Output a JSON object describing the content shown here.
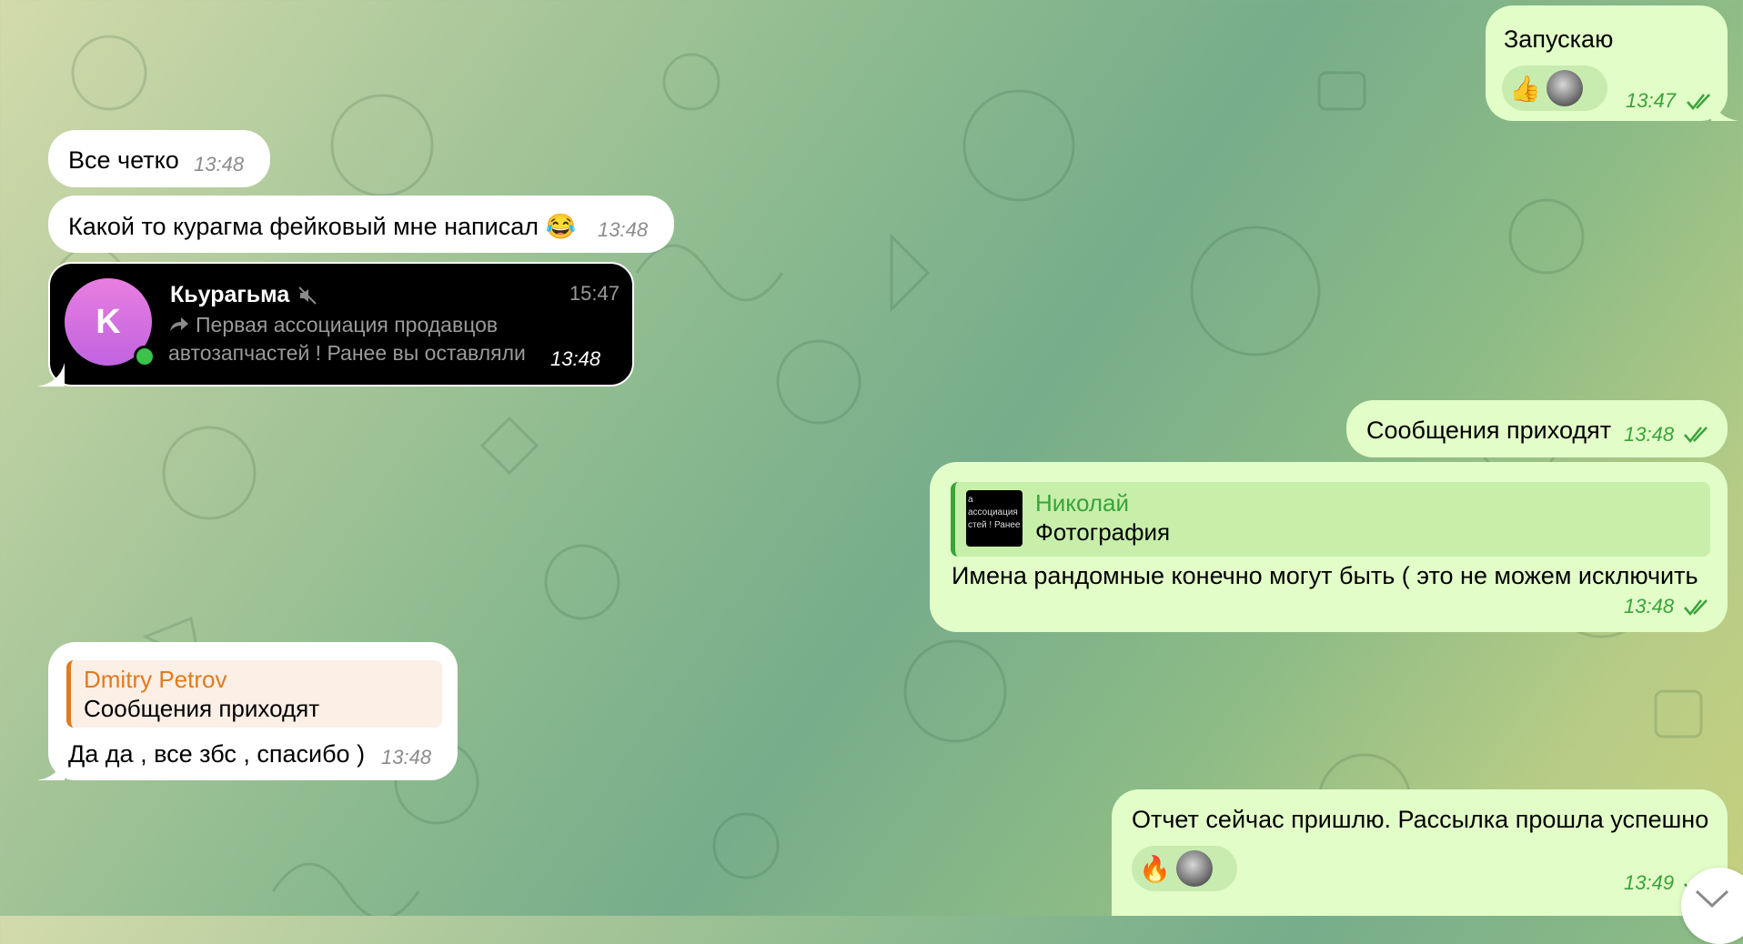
{
  "messages": {
    "m1": {
      "text": "Запускаю",
      "time": "13:47",
      "reaction": "👍"
    },
    "m2": {
      "text": "Все четко",
      "time": "13:48"
    },
    "m3": {
      "text": "Какой то курагма фейковый мне написал 😂",
      "time": "13:48"
    },
    "m4": {
      "avatar_letter": "K",
      "name": "Кьурагьма",
      "time_inner": "15:47",
      "preview_line1": "Первая ассоциация продавцов",
      "preview_line2": "автозапчастей ! Ранее вы оставляли",
      "time": "13:48"
    },
    "m5": {
      "text": "Сообщения приходят",
      "time": "13:48"
    },
    "m6": {
      "reply_author": "Николай",
      "reply_text": "Фотография",
      "thumb_line1": "а",
      "thumb_line2": "ассоциация",
      "thumb_line3": "стей ! Ранее",
      "text": "Имена рандомные конечно могут быть ( это не можем исключить",
      "time": "13:48"
    },
    "m7": {
      "reply_author": "Dmitry Petrov",
      "reply_text": "Сообщения приходят",
      "text": "Да да , все збс , спасибо )",
      "time": "13:48"
    },
    "m8": {
      "text": "Отчет сейчас пришлю. Рассылка прошла успешно",
      "time": "13:49",
      "reaction": "🔥"
    }
  },
  "colors": {
    "outgoing_bubble": "#e2fdc8",
    "incoming_bubble": "#ffffff",
    "time_out": "#3aa33a",
    "reply_green": "#3aa33a",
    "reply_orange": "#e07b1f"
  },
  "icons": {
    "scroll_down": "chevron-down-icon",
    "muted": "speaker-muted-icon",
    "forward": "forward-arrow-icon"
  }
}
